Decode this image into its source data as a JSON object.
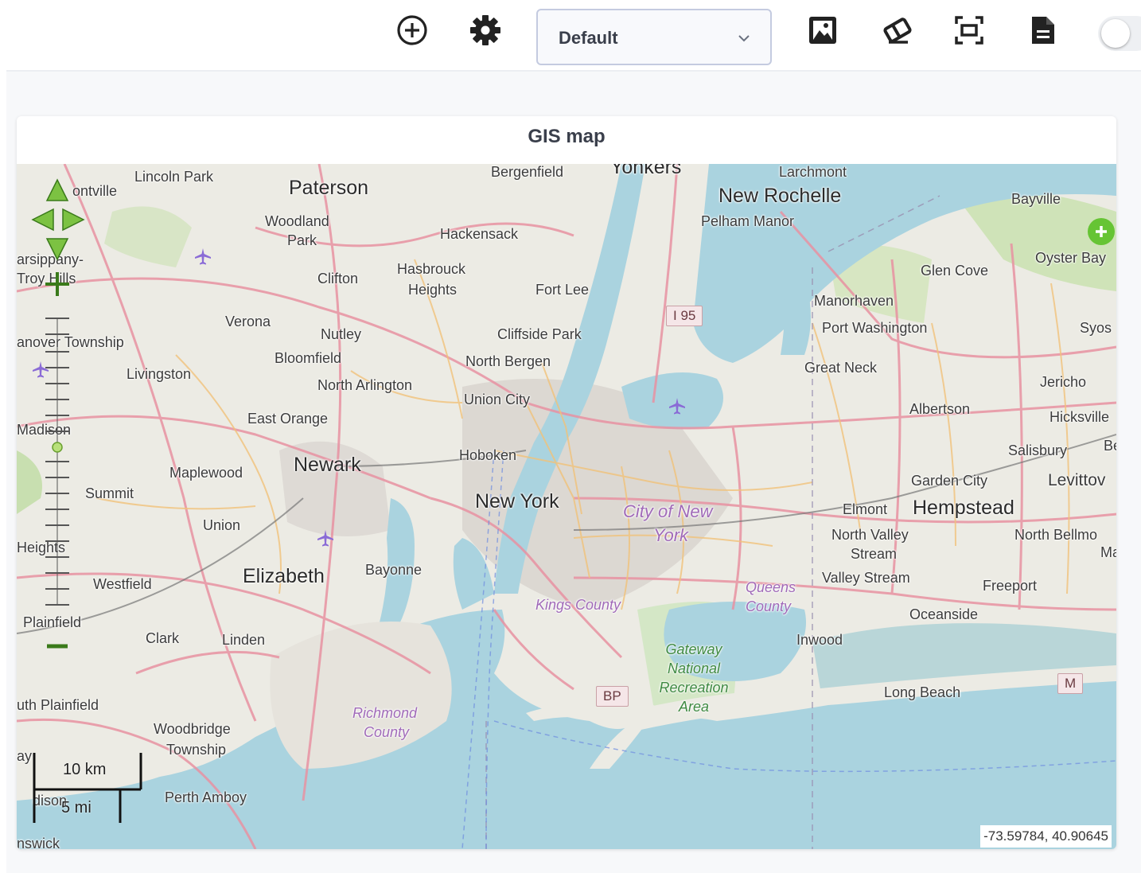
{
  "toolbar": {
    "icons": [
      "add-circle-icon",
      "gear-icon",
      "image-icon",
      "eraser-icon",
      "fit-screen-icon",
      "document-icon"
    ],
    "layout_select": {
      "value": "Default"
    },
    "toggle": {
      "on": false
    }
  },
  "card": {
    "title": "GIS map"
  },
  "map": {
    "coordinates": "-73.59784, 40.90645",
    "scale": {
      "km_label": "10 km",
      "mi_label": "5 mi"
    },
    "highway_shields": [
      "I 95",
      "BP",
      "M"
    ],
    "places": {
      "lincoln_park": "Lincoln Park",
      "montville": "ontville",
      "paterson": "Paterson",
      "bergenfield": "Bergenfield",
      "yonkers": "Yonkers",
      "larchmont": "Larchmont",
      "new_rochelle": "New Rochelle",
      "pelham_manor": "Pelham Manor",
      "bayville": "Bayville",
      "woodland_park_1": "Woodland",
      "woodland_park_2": "Park",
      "hackensack": "Hackensack",
      "parsippany_1": "arsippany-",
      "parsippany_2": "Troy Hills",
      "clifton": "Clifton",
      "hasbrouck_1": "Hasbrouck",
      "hasbrouck_2": "Heights",
      "fort_lee": "Fort Lee",
      "oyster_bay": "Oyster Bay",
      "glen_cove": "Glen Cove",
      "manorhaven": "Manorhaven",
      "verona": "Verona",
      "nutley": "Nutley",
      "hanover": "anover Township",
      "cliffside_park": "Cliffside Park",
      "port_washington": "Port Washington",
      "syosset": "Syos",
      "bloomfield": "Bloomfield",
      "north_bergen": "North Bergen",
      "great_neck": "Great Neck",
      "livingston": "Livingston",
      "north_arlington": "North Arlington",
      "jericho": "Jericho",
      "union_city": "Union City",
      "albertson": "Albertson",
      "hicksville": "Hicksville",
      "east_orange": "East Orange",
      "madison": "Madison",
      "hoboken": "Hoboken",
      "salisbury": "Salisbury",
      "bethpage": "Bet",
      "maplewood": "Maplewood",
      "newark": "Newark",
      "garden_city": "Garden City",
      "levittown": "Levittov",
      "summit": "Summit",
      "new_york": "New York",
      "city_of_ny_1": "City of New",
      "city_of_ny_2": "York",
      "elmont": "Elmont",
      "hempstead": "Hempstead",
      "union": "Union",
      "north_valley_1": "North Valley",
      "north_valley_2": "Stream",
      "north_bellmore": "North Bellmo",
      "heights": "Heights",
      "ma": "Ma",
      "bayonne": "Bayonne",
      "elizabeth": "Elizabeth",
      "valley_stream": "Valley Stream",
      "westfield": "Westfield",
      "queens_1": "Queens",
      "queens_2": "County",
      "kings_county": "Kings County",
      "freeport": "Freeport",
      "plainfield": "Plainfield",
      "oceanside": "Oceanside",
      "clark": "Clark",
      "linden": "Linden",
      "inwood": "Inwood",
      "gateway_1": "Gateway",
      "gateway_2": "National",
      "gateway_3": "Recreation",
      "gateway_4": "Area",
      "long_beach": "Long Beach",
      "south_plainfield": "uth Plainfield",
      "richmond_1": "Richmond",
      "richmond_2": "County",
      "woodbridge_1": "Woodbridge",
      "woodbridge_2": "Township",
      "bay": "ay",
      "edison": "dison",
      "perth_amboy": "Perth Amboy",
      "brunswick": "nswick"
    }
  }
}
